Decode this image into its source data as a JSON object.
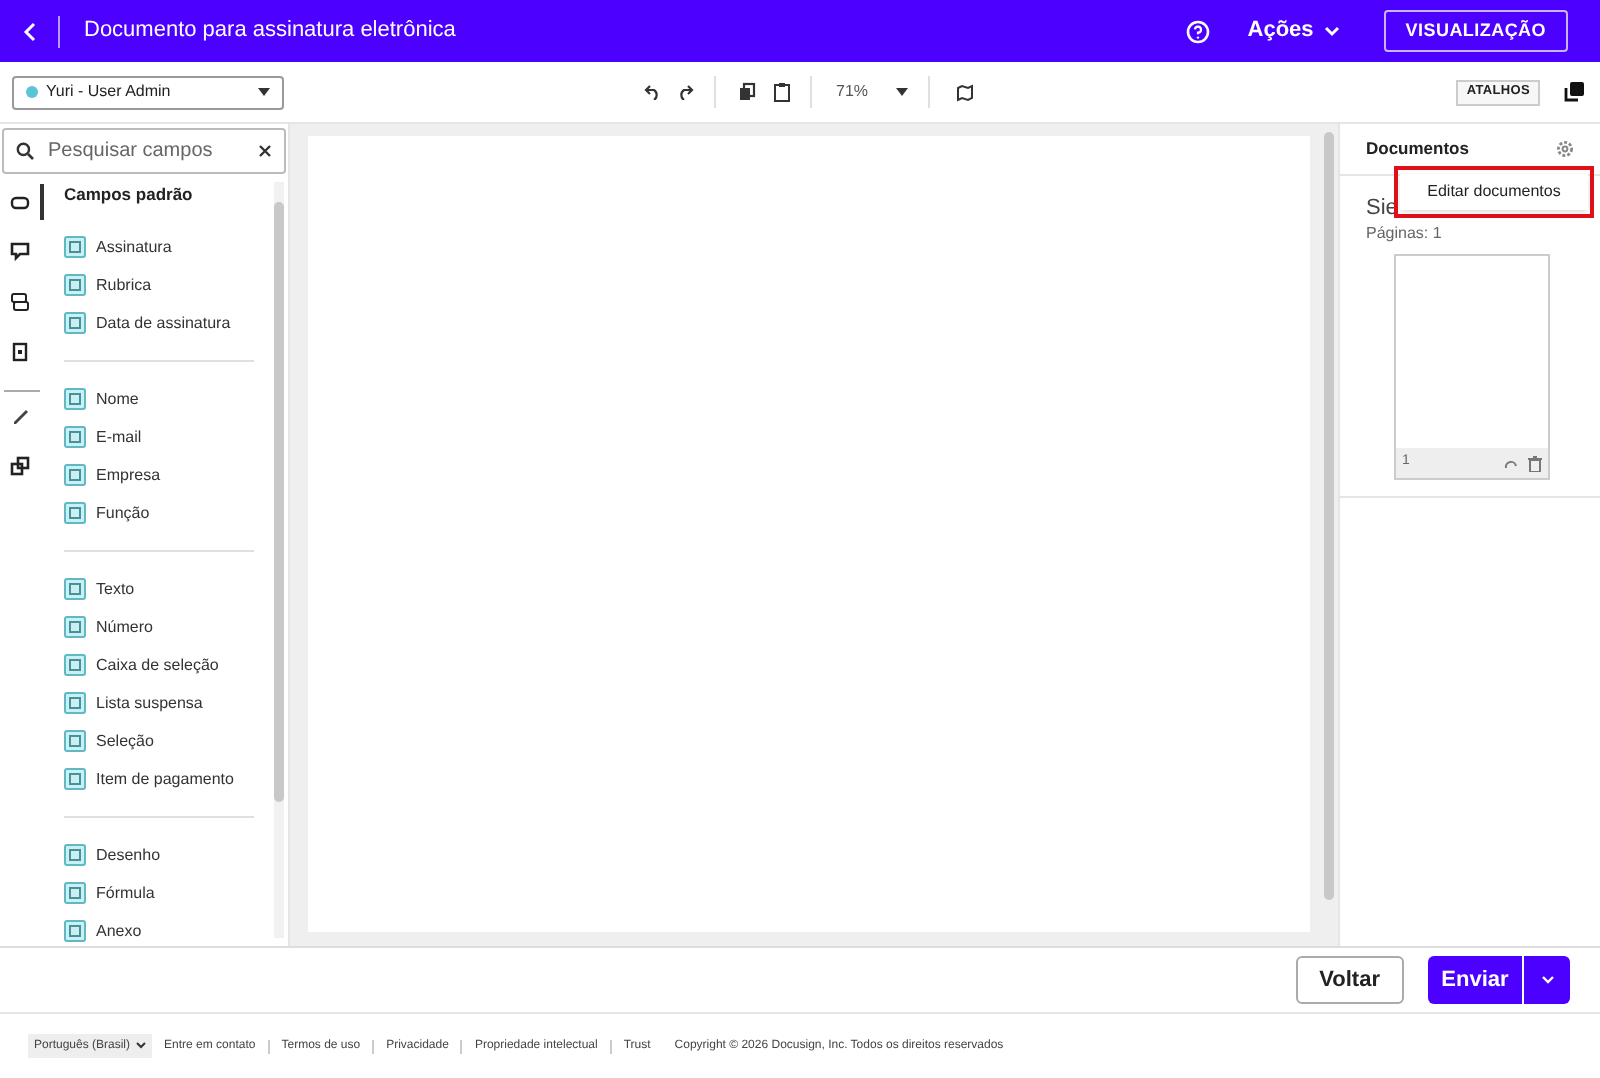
{
  "header": {
    "title": "Documento para assinatura eletrônica",
    "actions_label": "Ações",
    "preview_button": "VISUALIZAÇÃO"
  },
  "toolbar": {
    "recipient": "Yuri - User Admin",
    "zoom": "71%",
    "shortcuts_button": "ATALHOS"
  },
  "search": {
    "placeholder": "Pesquisar campos"
  },
  "rail": [
    {
      "selected": true
    },
    {
      "selected": false
    },
    {
      "selected": false
    },
    {
      "selected": false
    },
    {
      "selected": false
    },
    {
      "selected": false
    }
  ],
  "fields": {
    "heading": "Campos padrão",
    "groups": [
      {
        "items": [
          "Assinatura",
          "Rubrica",
          "Data de assinatura"
        ]
      },
      {
        "items": [
          "Nome",
          "E-mail",
          "Empresa",
          "Função"
        ]
      },
      {
        "items": [
          "Texto",
          "Número",
          "Caixa de seleção",
          "Lista suspensa",
          "Seleção",
          "Item de pagamento"
        ]
      },
      {
        "items": [
          "Desenho",
          "Fórmula",
          "Anexo"
        ]
      }
    ]
  },
  "documents": {
    "title": "Documentos",
    "menu_item": "Editar documentos",
    "doc_name": "Sie",
    "pages_label": "Páginas: 1",
    "page_number": "1"
  },
  "actions": {
    "back": "Voltar",
    "send": "Enviar"
  },
  "footer": {
    "language": "Português (Brasil)",
    "links": [
      "Entre em contato",
      "Termos de uso",
      "Privacidade",
      "Propriedade intelectual",
      "Trust"
    ],
    "copyright": "Copyright © 2026 Docusign, Inc. Todos os direitos reservados"
  }
}
